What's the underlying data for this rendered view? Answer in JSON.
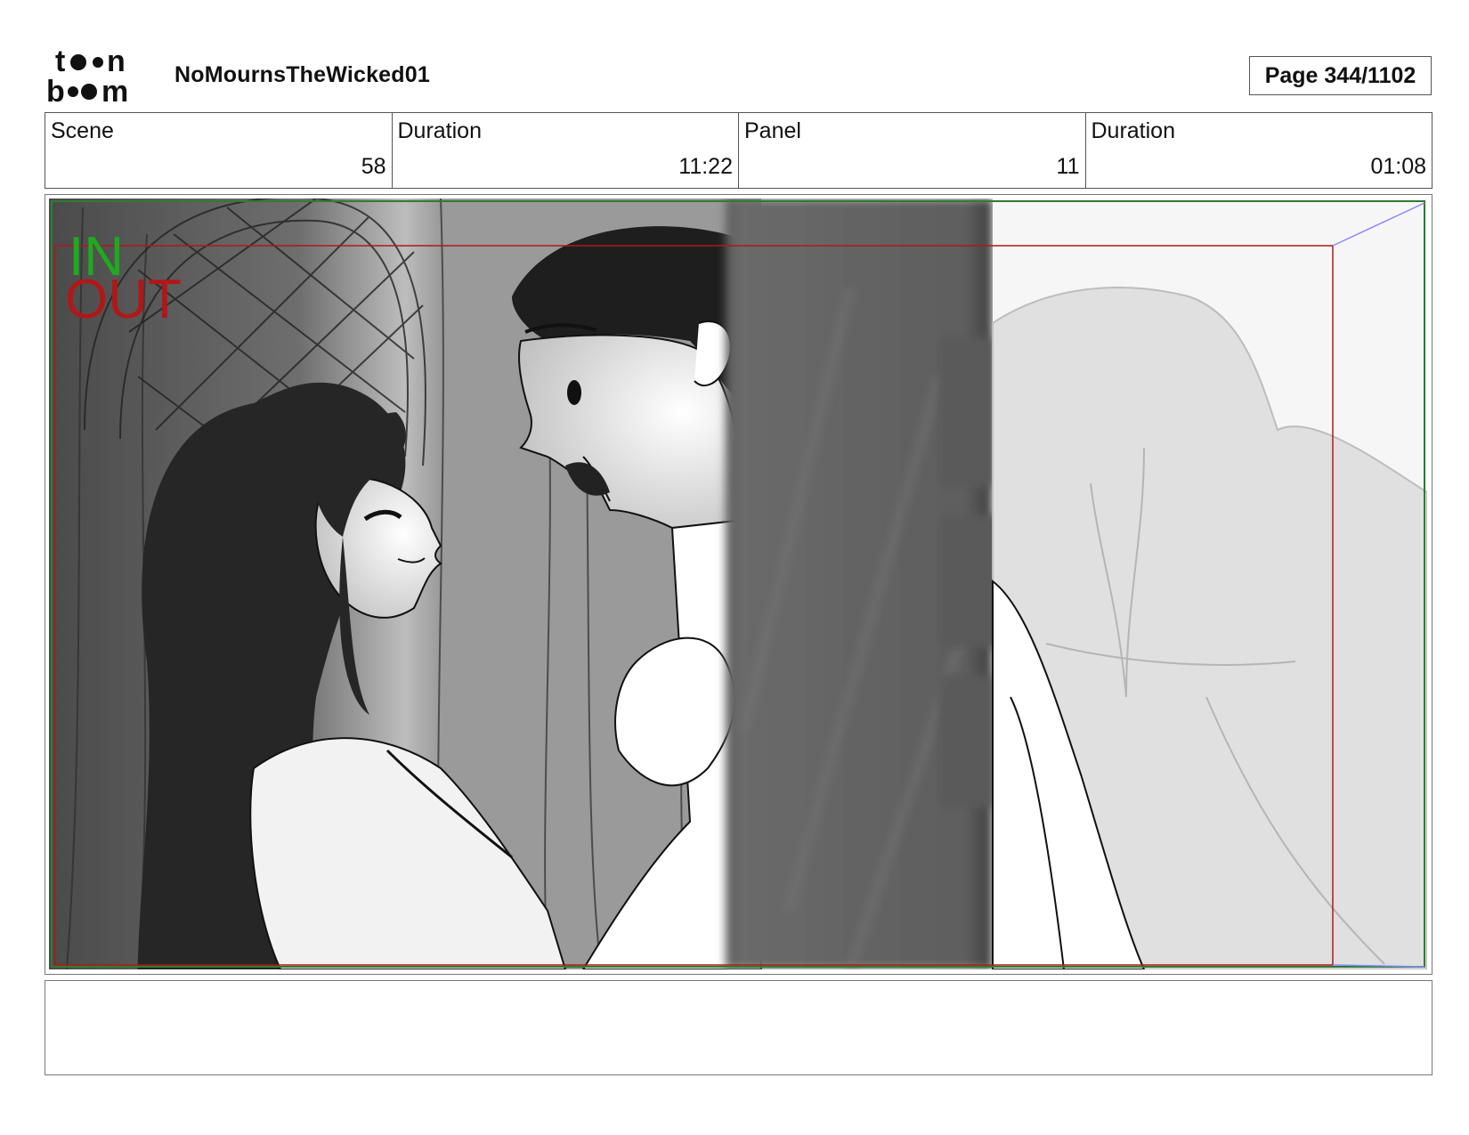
{
  "header": {
    "logo_text": "toon boom",
    "project_title": "NoMournsTheWicked01",
    "page_label": "Page  344/1102"
  },
  "info": {
    "scene_label": "Scene",
    "scene_value": "58",
    "scene_duration_label": "Duration",
    "scene_duration_value": "11:22",
    "panel_label": "Panel",
    "panel_value": "11",
    "panel_duration_label": "Duration",
    "panel_duration_value": "01:08"
  },
  "panel": {
    "in_label": "IN",
    "out_label": "OUT",
    "in_color": "#1faa1f",
    "out_color": "#b01818",
    "description": ""
  },
  "notes": {
    "text": ""
  }
}
